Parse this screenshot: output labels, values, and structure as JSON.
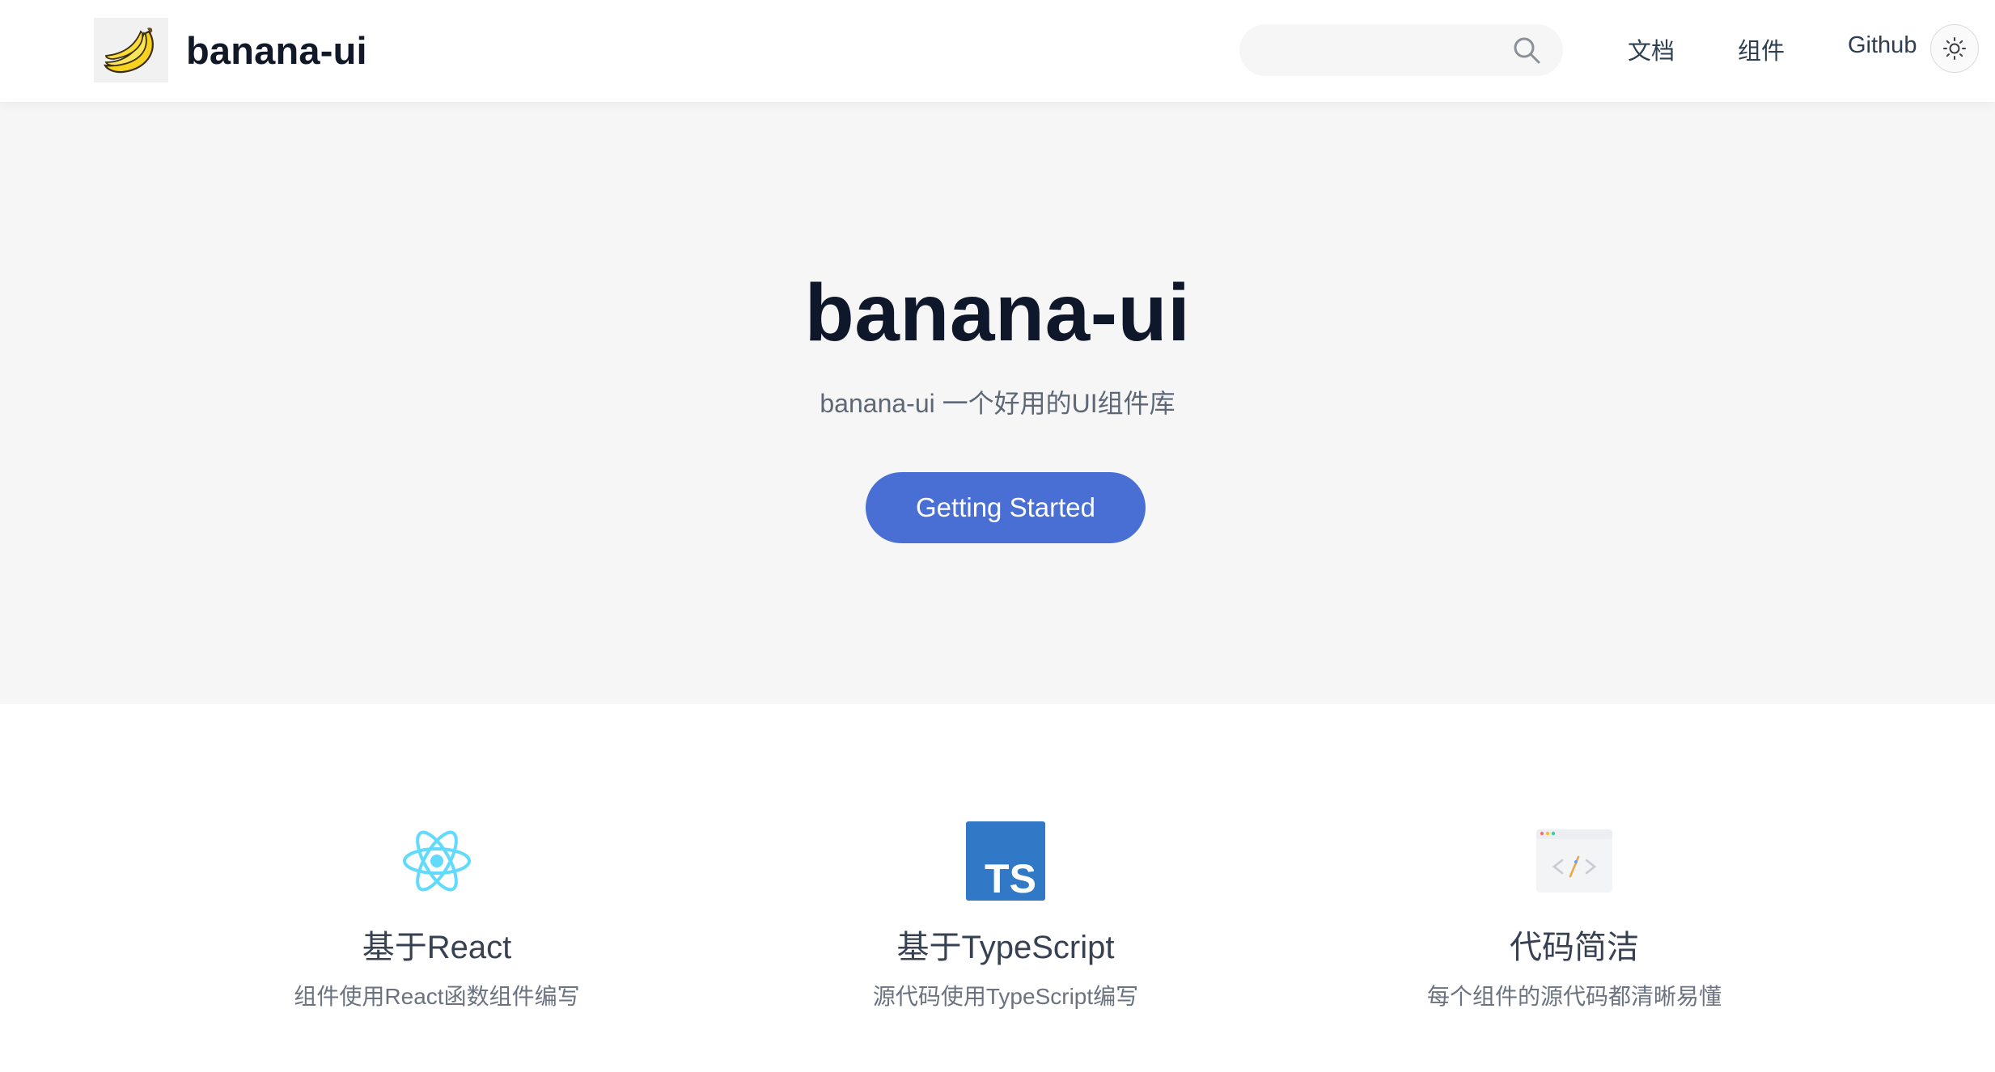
{
  "navbar": {
    "brand_title": "banana-ui",
    "logo_icon": "banana-logo-icon",
    "search": {
      "placeholder": "",
      "icon": "search-icon"
    },
    "links": [
      {
        "label": "文档"
      },
      {
        "label": "组件"
      },
      {
        "label": "Github"
      }
    ],
    "theme_toggle_icon": "sun-icon"
  },
  "hero": {
    "title": "banana-ui",
    "tagline": "banana-ui 一个好用的UI组件库",
    "button_label": "Getting Started"
  },
  "features": [
    {
      "icon": "react-icon",
      "title": "基于React",
      "description": "组件使用React函数组件编写"
    },
    {
      "icon": "typescript-icon",
      "title": "基于TypeScript",
      "description": "源代码使用TypeScript编写"
    },
    {
      "icon": "code-window-icon",
      "title": "代码简洁",
      "description": "每个组件的源代码都清晰易懂"
    }
  ],
  "colors": {
    "accent": "#4a6fd4",
    "hero_bg": "#f6f6f7",
    "react_blue": "#61dafb",
    "typescript_blue": "#3178c6",
    "banana_yellow": "#f7d21e"
  }
}
